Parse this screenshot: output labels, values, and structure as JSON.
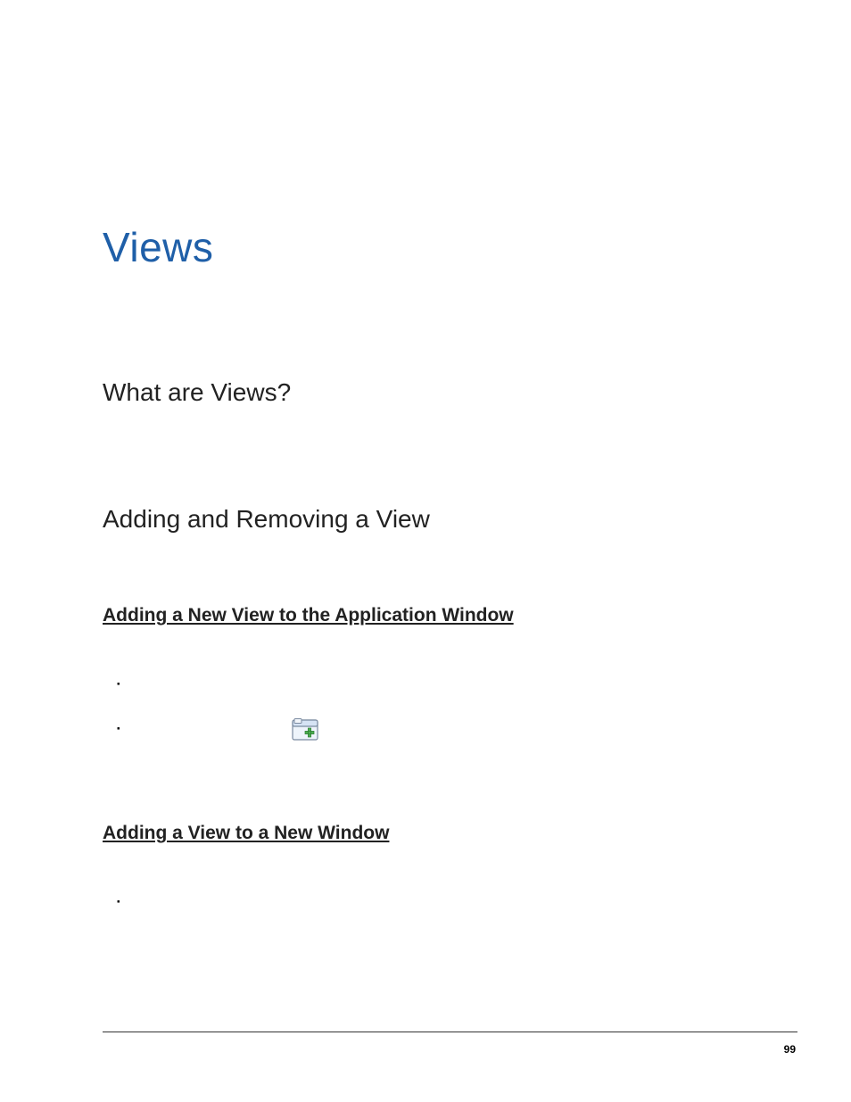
{
  "title": "Views",
  "sections": {
    "what": "What are Views?",
    "addremove": "Adding and Removing a View"
  },
  "subheadings": {
    "add_app_window": "Adding a New View to the Application Window",
    "add_new_window": "Adding a View to a New Window"
  },
  "page_number": "99"
}
